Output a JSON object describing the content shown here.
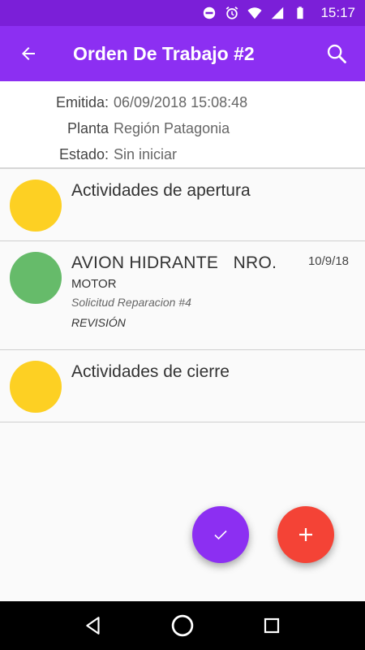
{
  "status_bar": {
    "time": "15:17"
  },
  "app_bar": {
    "title": "Orden De Trabajo #2"
  },
  "info": {
    "rows": [
      {
        "label": "Emitida:",
        "value": "06/09/2018 15:08:48"
      },
      {
        "label": "Planta",
        "value": "Región Patagonia"
      },
      {
        "label": "Estado:",
        "value": "Sin iniciar"
      }
    ]
  },
  "colors": {
    "primary": "#8c2ff2",
    "status_bar": "#7b1fd8",
    "yellow": "#fdd023",
    "green": "#66bb6a",
    "red": "#f44336"
  },
  "list": {
    "items": [
      {
        "title": "Actividades de apertura",
        "color": "#fdd023"
      },
      {
        "title": "AVION HIDRANTE   NRO.",
        "date": "10/9/18",
        "subtitle": "MOTOR",
        "request": "Solicitud Reparacion #4",
        "stage": "REVISIÓN",
        "color": "#66bb6a"
      },
      {
        "title": "Actividades de cierre",
        "color": "#fdd023"
      }
    ]
  },
  "fabs": {
    "check": "check-icon",
    "add": "plus-icon"
  }
}
